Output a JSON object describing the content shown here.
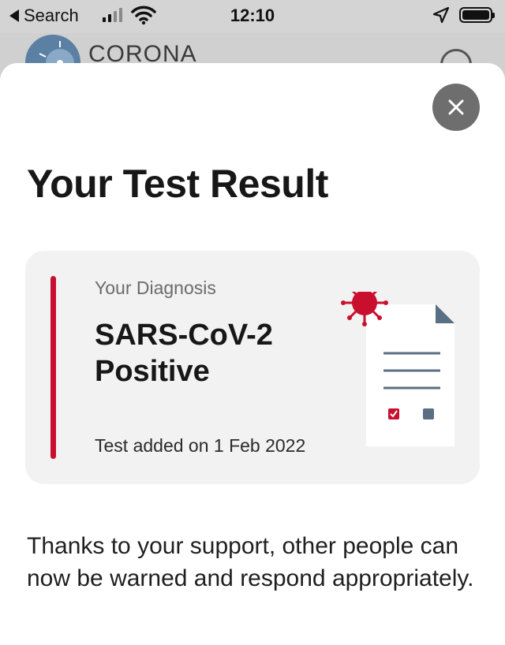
{
  "status_bar": {
    "back_label": "Search",
    "time": "12:10"
  },
  "background_app": {
    "title": "CORONA"
  },
  "sheet": {
    "title": "Your Test Result",
    "card": {
      "label": "Your Diagnosis",
      "diagnosis": "SARS-CoV-2 Positive",
      "date_text": "Test added on 1 Feb 2022",
      "accent_color": "#c8102e",
      "illustration": "positive-test-document-icon"
    },
    "info_text": "Thanks to your support, other people can now be warned and respond appropriately."
  },
  "icons": {
    "close": "close-icon",
    "location": "location-arrow-icon",
    "wifi": "wifi-icon",
    "battery": "battery-icon",
    "signal": "cellular-signal-icon"
  }
}
